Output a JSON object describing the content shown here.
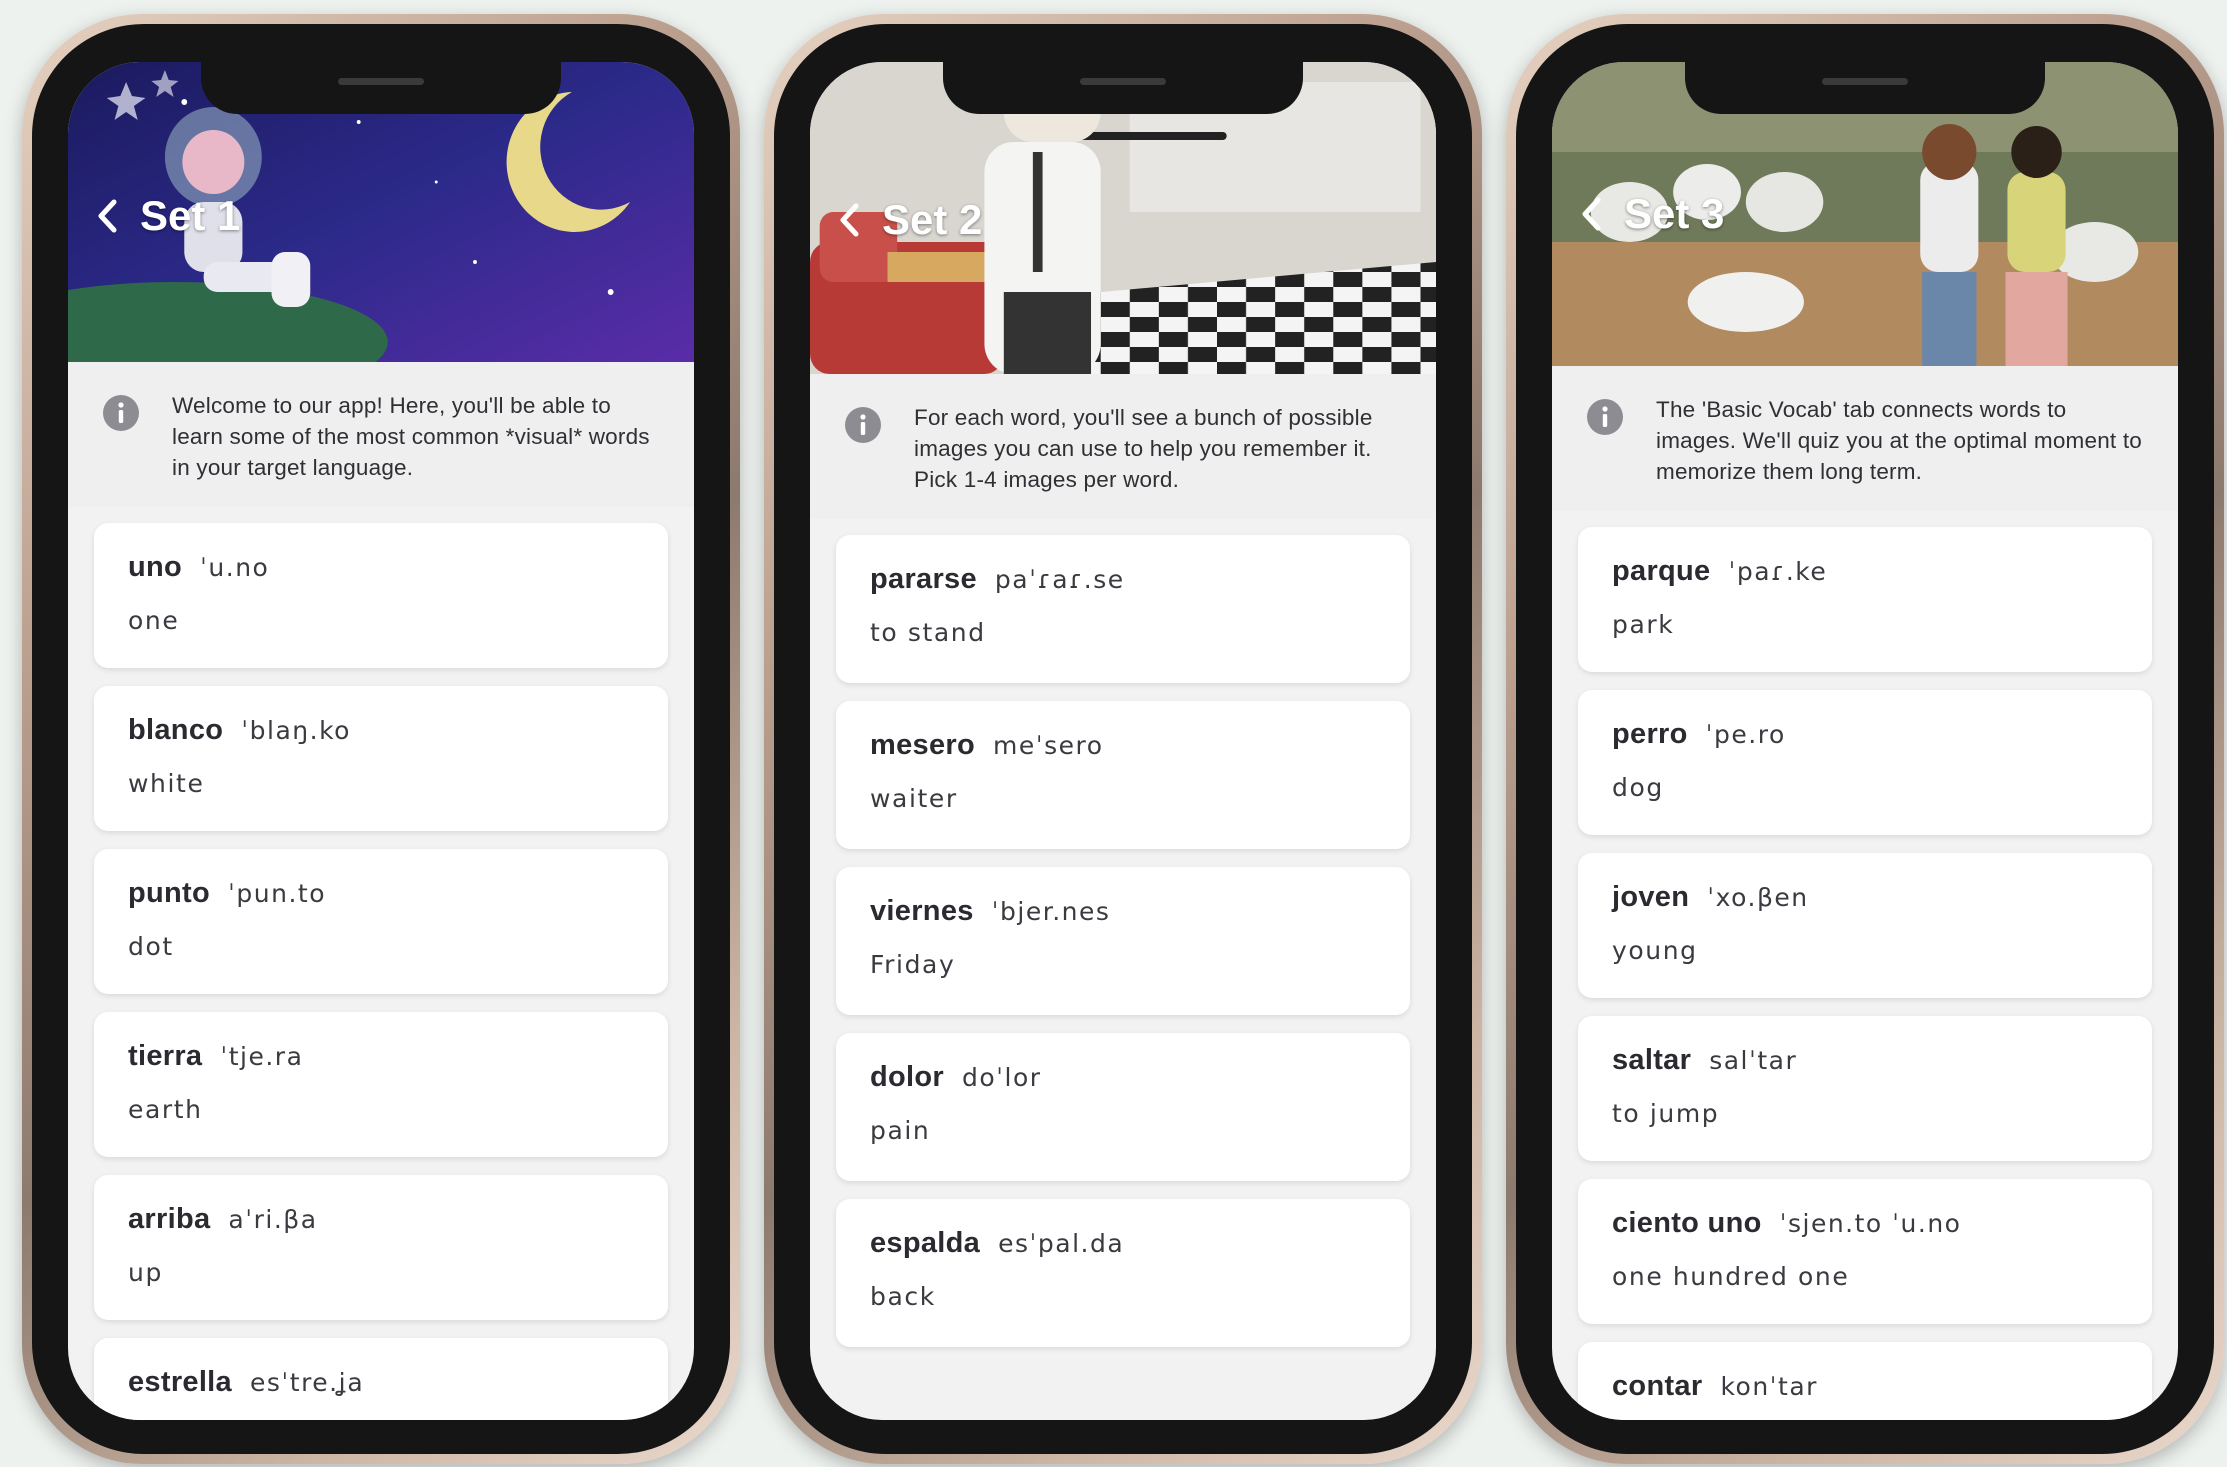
{
  "phones": [
    {
      "title": "Set 1",
      "info": "Welcome to our app! Here, you'll be able to learn some of the most common *visual* words in your target language.",
      "words": [
        {
          "word": "uno",
          "ipa": "ˈu.no",
          "gloss": "one"
        },
        {
          "word": "blanco",
          "ipa": "ˈblaŋ.ko",
          "gloss": "white"
        },
        {
          "word": "punto",
          "ipa": "ˈpun.to",
          "gloss": "dot"
        },
        {
          "word": "tierra",
          "ipa": "ˈtje.ra",
          "gloss": "earth"
        },
        {
          "word": "arriba",
          "ipa": "aˈri.βa",
          "gloss": "up"
        },
        {
          "word": "estrella",
          "ipa": "esˈtre.ʝa",
          "gloss": ""
        }
      ]
    },
    {
      "title": "Set 2",
      "info": "For each word, you'll see a bunch of possible images you can use to help you remember it. Pick 1-4 images per word.",
      "words": [
        {
          "word": "pararse",
          "ipa": "paˈɾaɾ.se",
          "gloss": "to stand"
        },
        {
          "word": "mesero",
          "ipa": "meˈsero",
          "gloss": "waiter"
        },
        {
          "word": "viernes",
          "ipa": "ˈbjer.nes",
          "gloss": "Friday"
        },
        {
          "word": "dolor",
          "ipa": "doˈlor",
          "gloss": "pain"
        },
        {
          "word": "espalda",
          "ipa": "esˈpal.da",
          "gloss": "back"
        }
      ]
    },
    {
      "title": "Set 3",
      "info": "The 'Basic Vocab' tab connects words to images. We'll quiz you at the optimal moment to memorize them long term.",
      "words": [
        {
          "word": "parque",
          "ipa": "ˈpaɾ.ke",
          "gloss": "park"
        },
        {
          "word": "perro",
          "ipa": "ˈpe.ro",
          "gloss": "dog"
        },
        {
          "word": "joven",
          "ipa": "ˈxo.βen",
          "gloss": "young"
        },
        {
          "word": "saltar",
          "ipa": "salˈtar",
          "gloss": "to jump"
        },
        {
          "word": "ciento uno",
          "ipa": "ˈsjen.to ˈu.no",
          "gloss": "one hundred one"
        },
        {
          "word": "contar",
          "ipa": "konˈtar",
          "gloss": ""
        }
      ]
    }
  ],
  "icons": {
    "back": "chevron-left-icon",
    "info": "info-icon"
  },
  "colors": {
    "card": "#ffffff",
    "info_bg": "#efeff0",
    "screen_bg": "#f2f2f3",
    "text": "#2a2a30"
  }
}
